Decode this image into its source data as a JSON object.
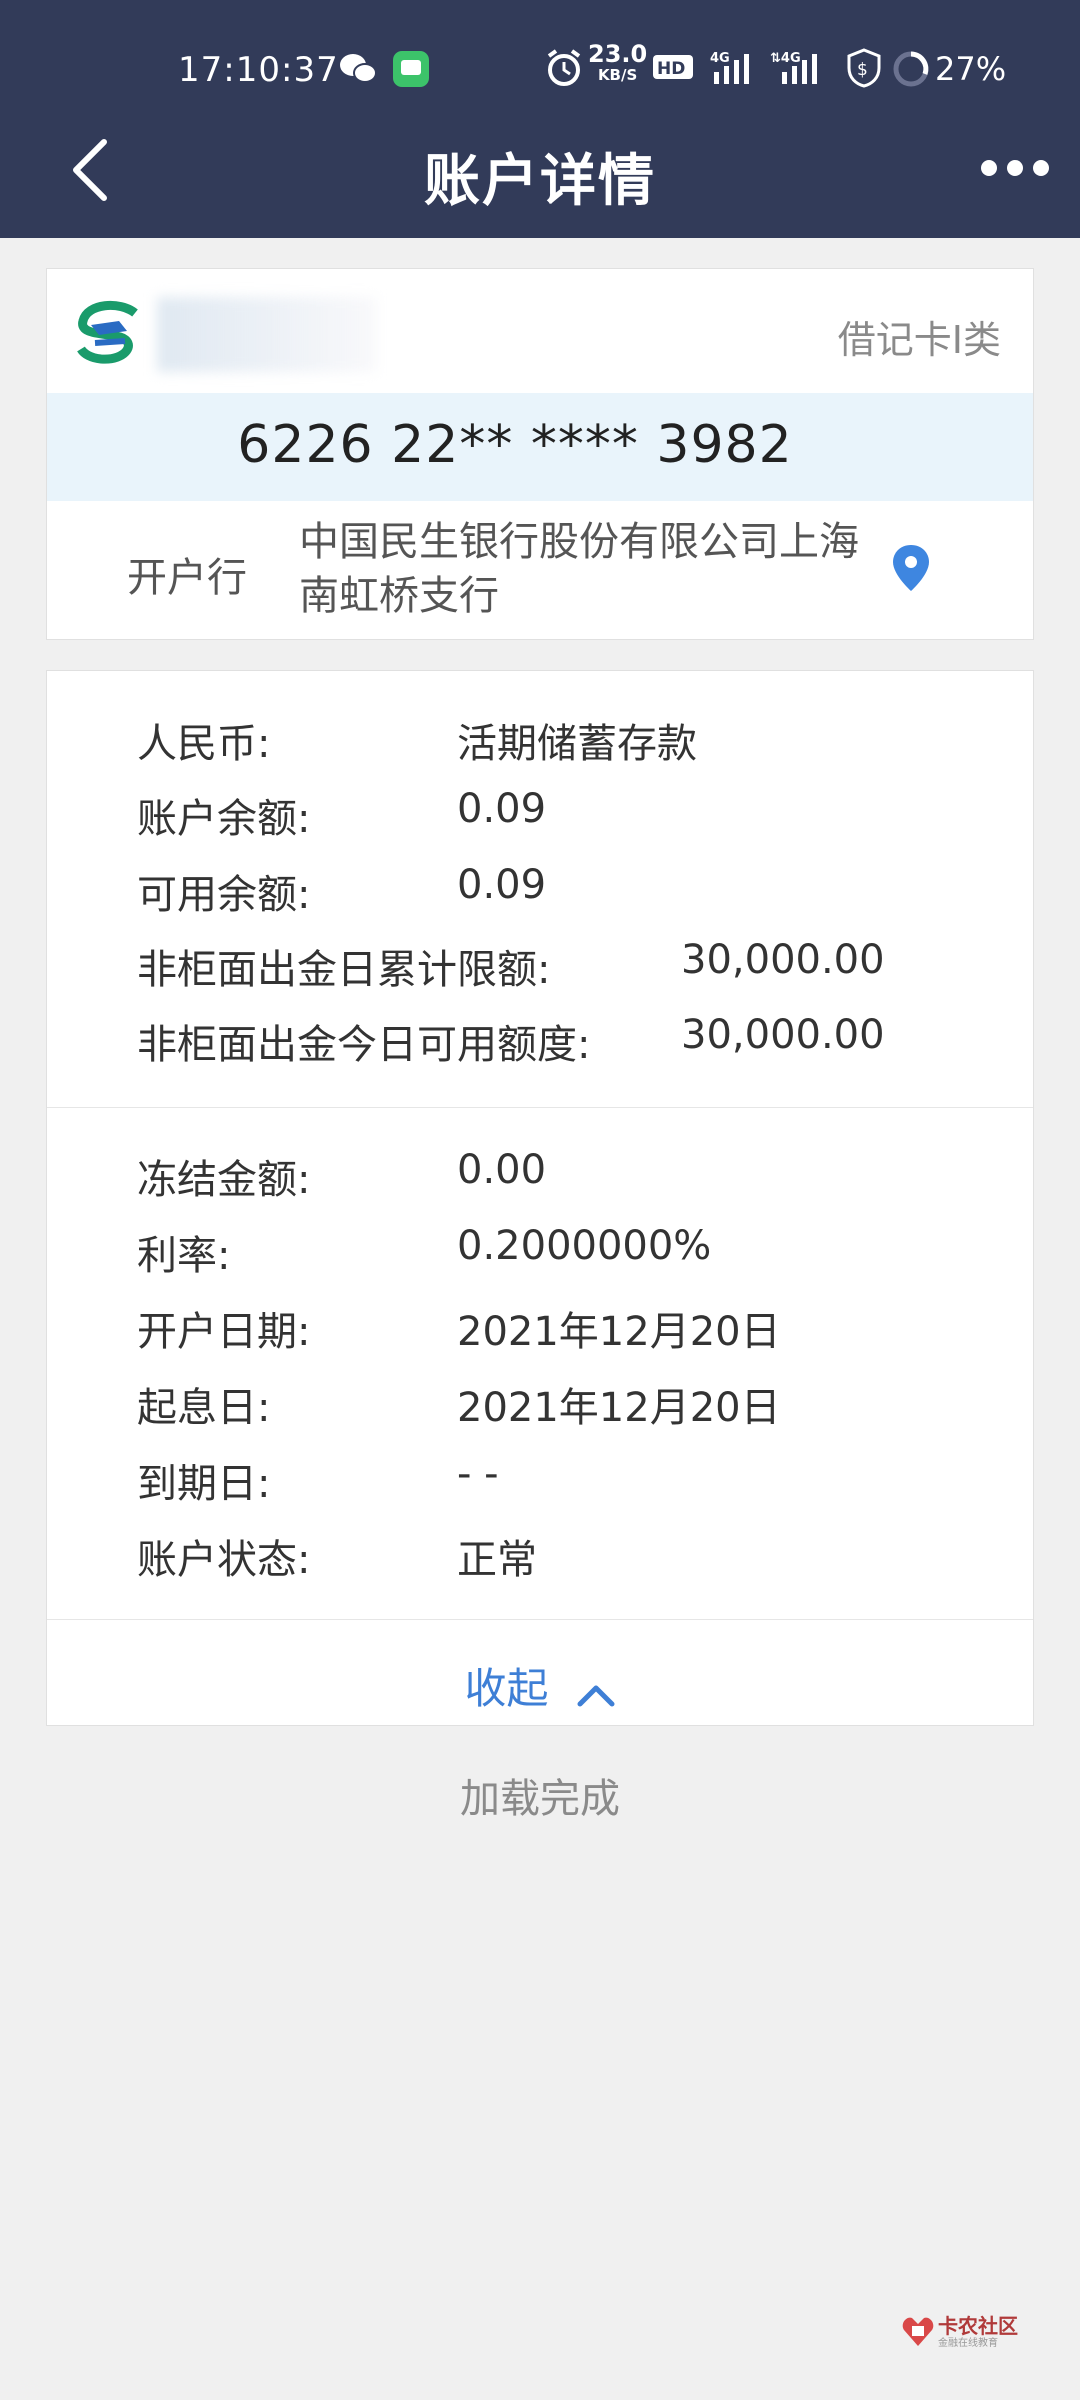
{
  "status_bar": {
    "time": "17:10:37",
    "net_speed_value": "23.0",
    "net_speed_unit": "KB/S",
    "battery": "27%"
  },
  "header": {
    "title": "账户详情"
  },
  "account_card": {
    "card_type": "借记卡I类",
    "card_number": "6226 22** **** 3982",
    "branch_label": "开户行",
    "branch_name": "中国民生银行股份有限公司上海南虹桥支行"
  },
  "details": {
    "section1": [
      {
        "label": "人民币:",
        "value": "活期储蓄存款"
      },
      {
        "label": "账户余额:",
        "value": "0.09"
      },
      {
        "label": "可用余额:",
        "value": "0.09"
      },
      {
        "label": "非柜面出金日累计限额:",
        "value": "30,000.00"
      },
      {
        "label": "非柜面出金今日可用额度:",
        "value": "30,000.00"
      }
    ],
    "section2": [
      {
        "label": "冻结金额:",
        "value": "0.00"
      },
      {
        "label": "利率:",
        "value": "0.2000000%"
      },
      {
        "label": "开户日期:",
        "value": "2021年12月20日"
      },
      {
        "label": "起息日:",
        "value": "2021年12月20日"
      },
      {
        "label": "到期日:",
        "value": "- -"
      },
      {
        "label": "账户状态:",
        "value": "正常"
      }
    ],
    "collapse_label": "收起"
  },
  "footer": {
    "loaded_text": "加载完成"
  },
  "watermark": {
    "text": "卡农社区",
    "sub": "金融在线教育"
  },
  "colors": {
    "header_bg": "#323b59",
    "accent_blue": "#3e7fd6",
    "card_number_bg": "#e9f4fb"
  }
}
